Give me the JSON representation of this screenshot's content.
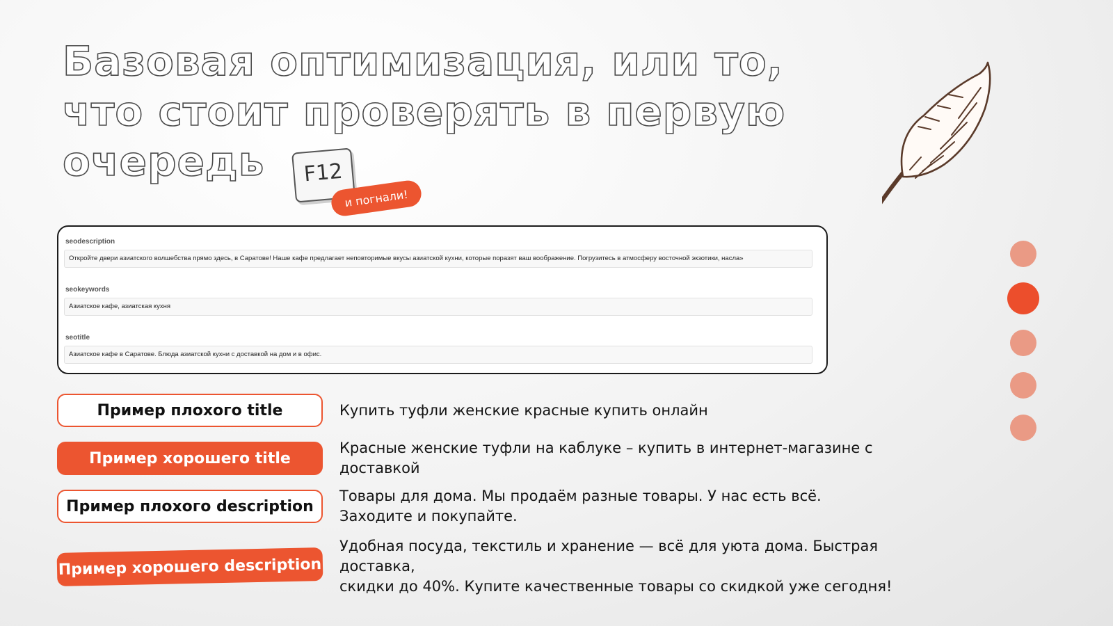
{
  "title": {
    "line1": "Базовая оптимизация, или то,",
    "line2": "что стоит проверять в первую",
    "line3": "очередь"
  },
  "key_badge": "F12",
  "go_badge": "и погнали!",
  "seo_panel": {
    "fields": [
      {
        "label": "seodescription",
        "value": "Откройте двери азиатского волшебства прямо здесь, в Саратове! Наше кафе предлагает неповторимые вкусы азиатской кухни, которые поразят ваш воображение. Погрузитесь в атмосферу восточной экзотики, насла»"
      },
      {
        "label": "seokeywords",
        "value": "Азиатское кафе, азиатская кухня"
      },
      {
        "label": "seotitle",
        "value": "Азиатское кафе в Саратове. Блюда азиатской кухни с доставкой на дом и в офис."
      }
    ]
  },
  "examples": [
    {
      "label": "Пример плохого title",
      "text": "Купить туфли женские красные купить онлайн"
    },
    {
      "label": "Пример хорошего title",
      "text": "Красные женские туфли на каблуке – купить в интернет-магазине с доставкой"
    },
    {
      "label": "Пример плохого description",
      "text_line1": "Товары для дома. Мы продаём разные товары. У нас есть всё.",
      "text_line2": "Заходите и покупайте."
    },
    {
      "label": "Пример хорошего description",
      "text_line1": "Удобная посуда, текстиль и хранение — всё для уюта дома. Быстрая доставка,",
      "text_line2": "скидки до 40%. Купите качественные товары со скидкой уже сегодня!"
    }
  ],
  "pagination": {
    "total": 5,
    "active_index": 1
  },
  "colors": {
    "accent": "#ec5530",
    "dot_inactive": "#ea9a85",
    "dot_active": "#ec4e2c",
    "feather_stroke": "#5a3a2a"
  },
  "icons": {
    "decoration": "feather-icon"
  }
}
